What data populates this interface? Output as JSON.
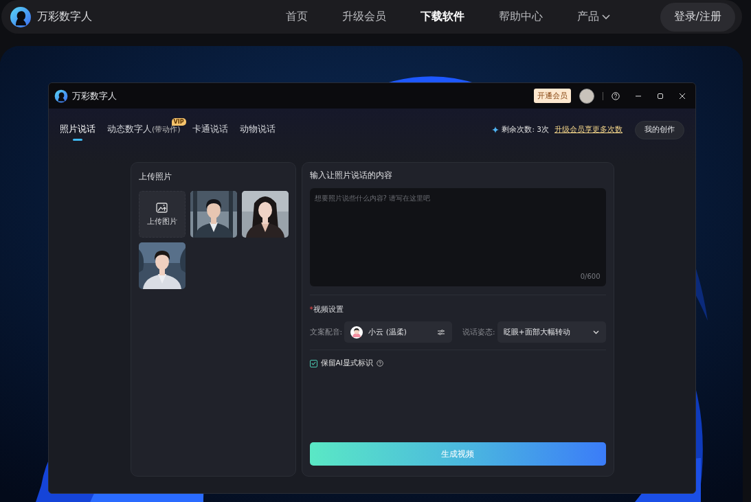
{
  "nav": {
    "brand": "万彩数字人",
    "links": [
      {
        "label": "首页",
        "selected": false
      },
      {
        "label": "升级会员",
        "selected": false
      },
      {
        "label": "下载软件",
        "selected": true
      },
      {
        "label": "帮助中心",
        "selected": false
      },
      {
        "label": "产品",
        "selected": false,
        "dropdown": true
      }
    ],
    "login": "登录/注册"
  },
  "window": {
    "title": "万彩数字人",
    "vip_button": "开通会员",
    "tabs": [
      {
        "label": "照片说话",
        "selected": true
      },
      {
        "label": "动态数字人",
        "suffix": "(带动作)",
        "badge": "VIP",
        "selected": false
      },
      {
        "label": "卡通说话",
        "selected": false
      },
      {
        "label": "动物说话",
        "selected": false
      }
    ],
    "remaining": "剩余次数: 3次",
    "upgrade_link": "升级会员享更多次数",
    "my_creations": "我的创作",
    "upload_panel": {
      "title": "上传照片",
      "upload_label": "上传图片"
    },
    "content_panel": {
      "title": "输入让照片说话的内容",
      "placeholder": "想要照片说些什么内容? 请写在这里吧",
      "counter": "0/600",
      "settings_title": "视频设置",
      "required_mark": "*",
      "voice_label": "文案配音:",
      "voice_value": "小云 (温柔)",
      "pose_label": "说话姿态:",
      "pose_value": "眨眼+面部大幅转动",
      "ai_mark": {
        "label": "保留AI显式标识",
        "checked": true
      },
      "generate": "生成视频"
    }
  }
}
